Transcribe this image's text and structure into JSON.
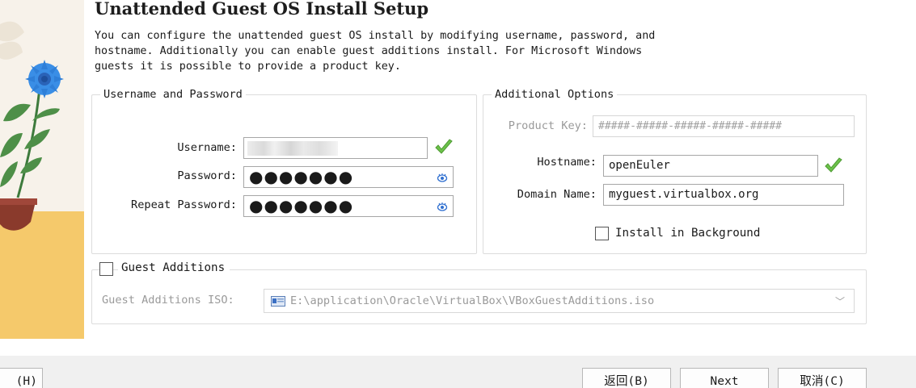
{
  "page": {
    "title": "Unattended Guest OS Install Setup",
    "description": "You can configure the unattended guest OS install by modifying username, password, and\nhostname. Additionally you can enable guest additions install. For Microsoft Windows\nguests it is possible to provide a product key."
  },
  "user_group": {
    "legend": "Username and Password",
    "username_label": "Username:",
    "username_value": "",
    "password_label": "Password:",
    "password_value": "●●●●●●●",
    "repeat_label": "Repeat Password:",
    "repeat_value": "●●●●●●●"
  },
  "options_group": {
    "legend": "Additional Options",
    "product_key_label": "Product Key:",
    "product_key_placeholder": "#####-#####-#####-#####-#####",
    "hostname_label": "Hostname:",
    "hostname_value": "openEuler",
    "domain_label": "Domain Name:",
    "domain_value": "myguest.virtualbox.org",
    "install_bg_label": "Install in Background",
    "install_bg_checked": false
  },
  "guest_additions": {
    "label": "Guest Additions",
    "checked": false,
    "iso_label": "Guest Additions ISO:",
    "iso_path": "E:\\application\\Oracle\\VirtualBox\\VBoxGuestAdditions.iso"
  },
  "buttons": {
    "help": "(H)",
    "back": "返回(B)",
    "next": "Next",
    "cancel": "取消(C)"
  },
  "colors": {
    "valid_check": "#6cc24a",
    "side_art_floor": "#f5c96b",
    "flower": "#3a8ee6"
  }
}
